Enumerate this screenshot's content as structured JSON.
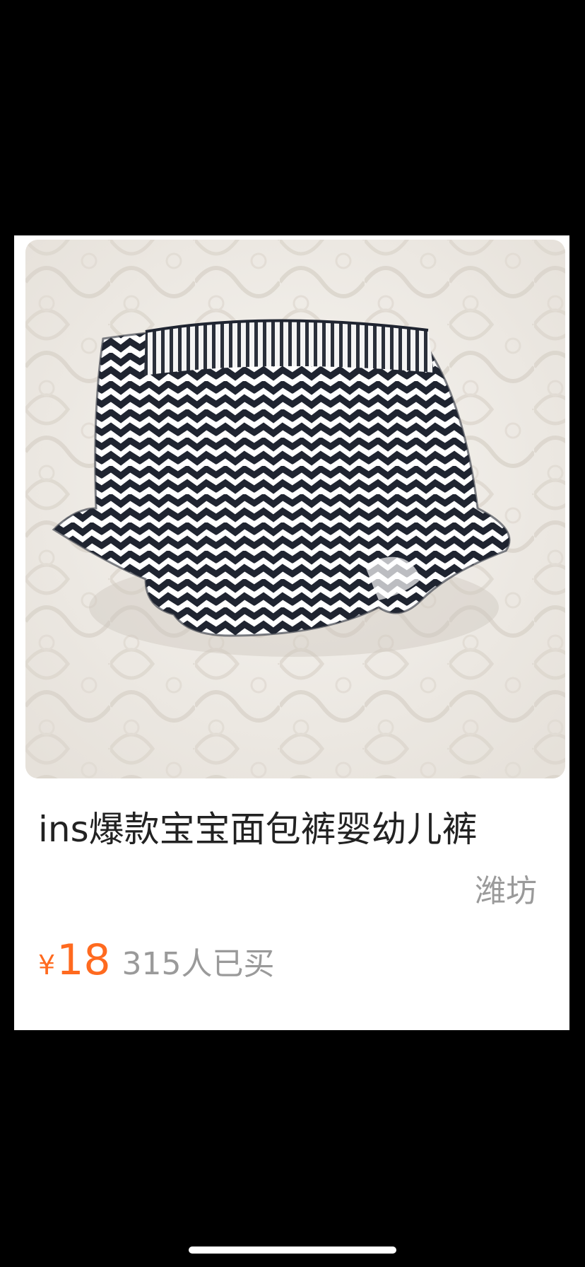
{
  "product": {
    "title": "ins爆款宝宝面包裤婴幼儿裤",
    "location": "潍坊",
    "currency_symbol": "¥",
    "price": "18",
    "sold_count": "315人已买",
    "price_color": "#ff6a1f"
  }
}
